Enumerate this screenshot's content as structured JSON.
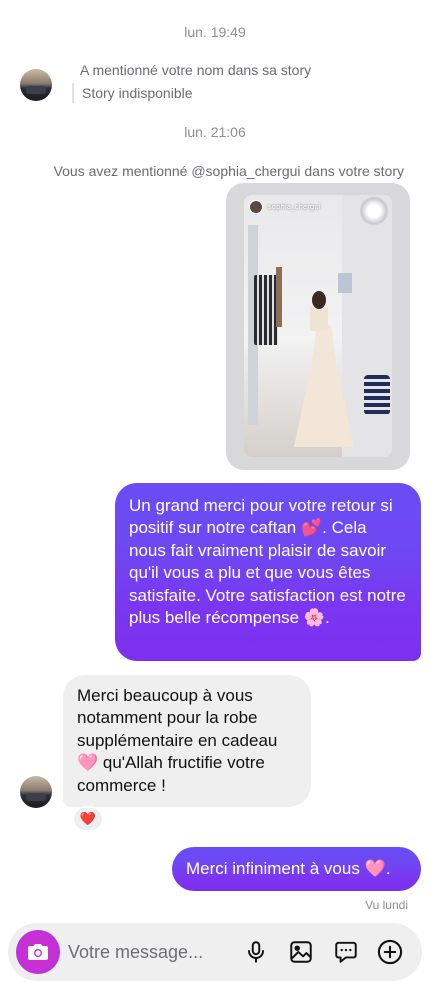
{
  "thread": {
    "timestamp_1": "lun. 19:49",
    "incoming_mention": "A mentionné votre nom dans sa story",
    "story_unavailable": "Story indisponible",
    "timestamp_2": "lun. 21:06",
    "outgoing_mention": "Vous avez mentionné @sophia_chergui dans votre story",
    "story_username": "sophia_chergui",
    "outgoing_message_1": "Un grand merci pour votre retour si positif sur notre caftan 💕. Cela nous fait vraiment plaisir de savoir qu'il vous a plu et que vous êtes satisfaite. Votre satisfaction est notre plus belle récompense 🌸.",
    "incoming_message": "Merci beaucoup à vous notamment pour la robe supplémentaire en cadeau 🩷 qu'Allah fructifie votre commerce !",
    "reaction": "❤️",
    "outgoing_message_2": "Merci infiniment à vous 🩷.",
    "seen_status": "Vu lundi"
  },
  "composer": {
    "placeholder": "Votre message...",
    "icons": [
      "camera-icon",
      "microphone-icon",
      "gallery-icon",
      "sticker-icon",
      "add-icon"
    ]
  },
  "colors": {
    "bubble_gradient_top": "#6a4cf5",
    "bubble_gradient_bottom": "#7c30ef",
    "camera_button": "#c231d8",
    "incoming_bubble": "#efeff0"
  }
}
